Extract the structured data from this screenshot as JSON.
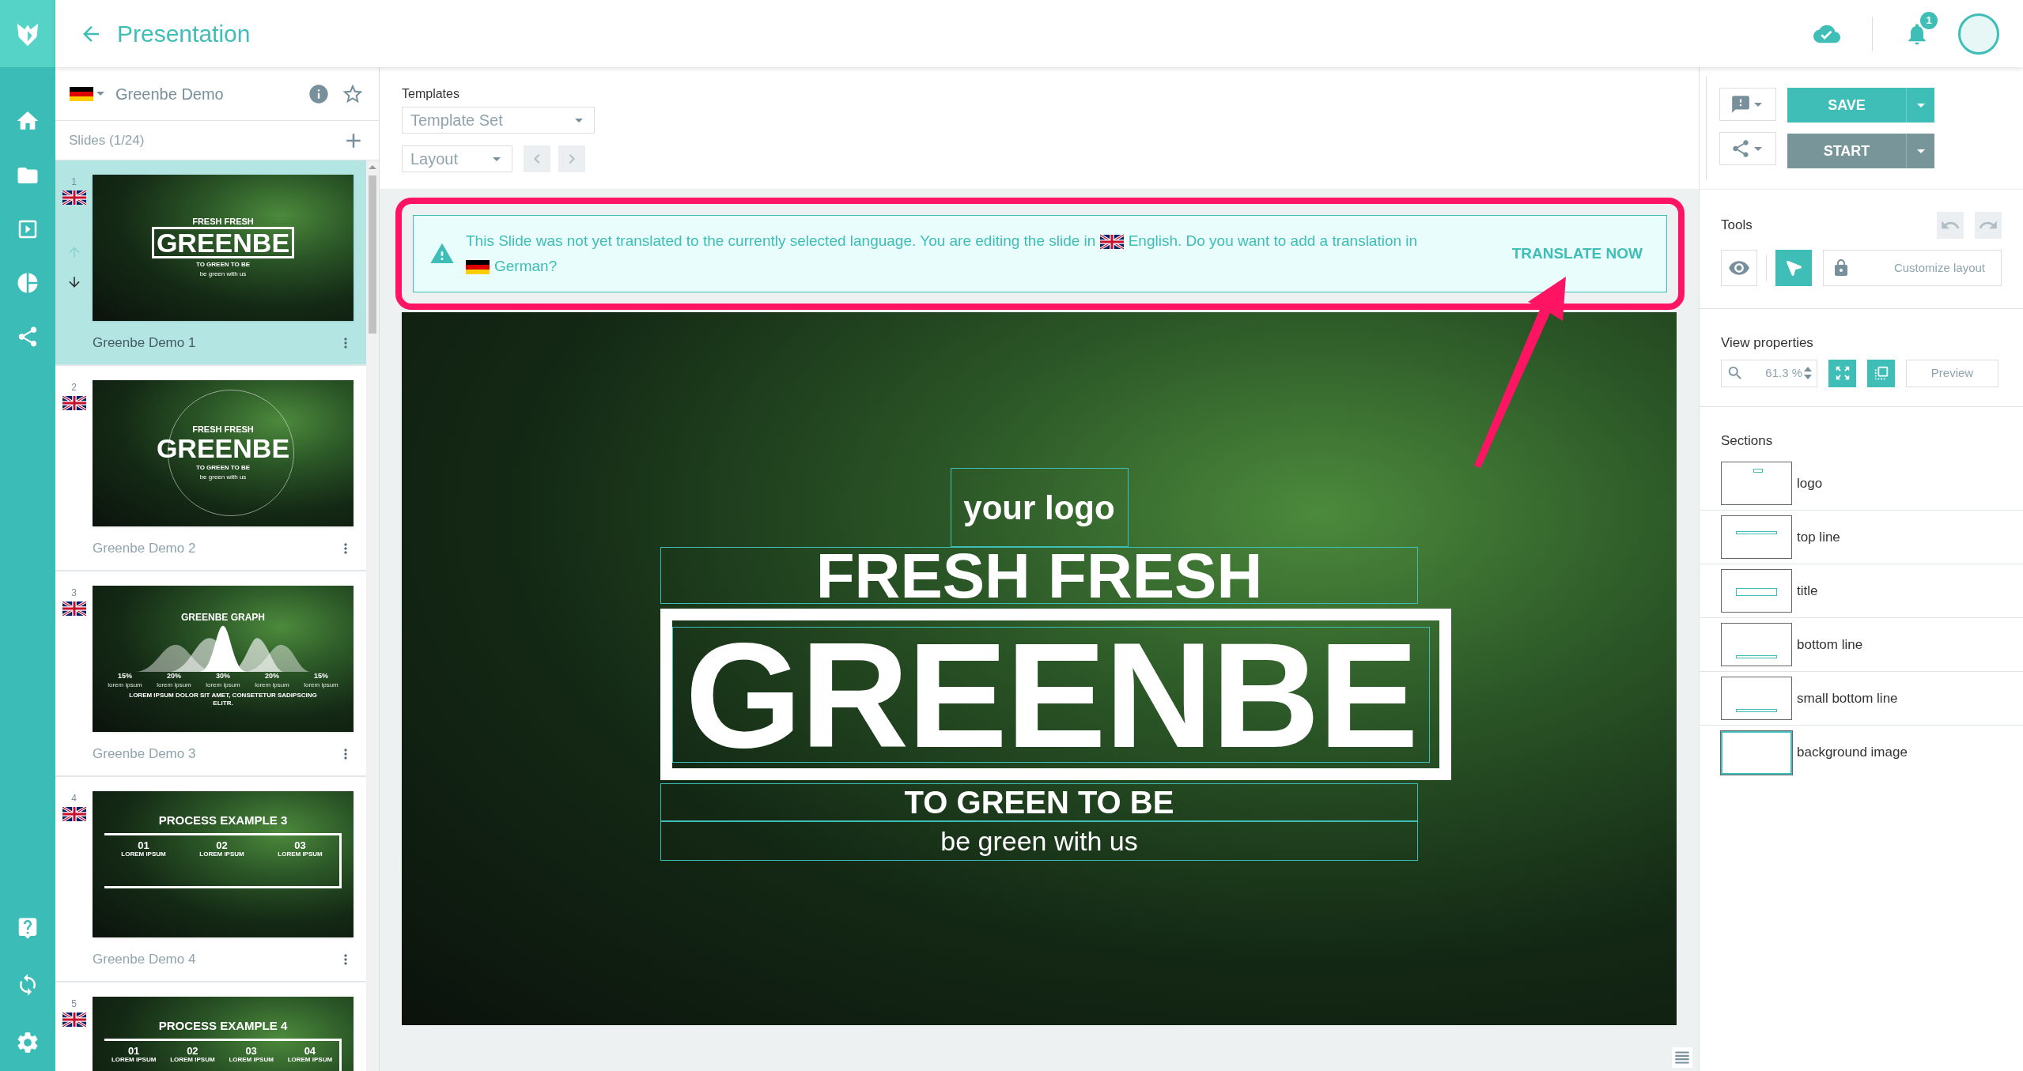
{
  "header": {
    "title": "Presentation",
    "notification_count": "1"
  },
  "presentation": {
    "name": "Greenbe Demo",
    "starred": false
  },
  "slides_header": {
    "label": "Slides (1/24)"
  },
  "move_controls": {
    "up_disabled": true,
    "down_disabled": false
  },
  "slides": [
    {
      "number": "1",
      "title": "Greenbe Demo 1",
      "selected": true,
      "thumb": {
        "kind": "title-box",
        "heading": "FRESH FRESH",
        "title": "GREENBE",
        "subtitle": "TO GREEN TO BE",
        "tagline": "be green with us"
      }
    },
    {
      "number": "2",
      "title": "Greenbe Demo 2",
      "selected": false,
      "thumb": {
        "kind": "title-circle",
        "heading": "FRESH FRESH",
        "title": "GREENBE",
        "subtitle": "TO GREEN TO BE",
        "tagline": "be green with us"
      }
    },
    {
      "number": "3",
      "title": "Greenbe Demo 3",
      "selected": false,
      "thumb": {
        "kind": "graph",
        "title": "GREENBE GRAPH",
        "items": [
          {
            "value": "15%",
            "label": "lorem ipsum"
          },
          {
            "value": "20%",
            "label": "lorem ipsum"
          },
          {
            "value": "30%",
            "label": "lorem ipsum"
          },
          {
            "value": "20%",
            "label": "lorem ipsum"
          },
          {
            "value": "15%",
            "label": "lorem ipsum"
          }
        ],
        "caption": "LOREM IPSUM DOLOR SIT AMET, CONSETETUR SADIPSCING ELITR."
      }
    },
    {
      "number": "4",
      "title": "Greenbe Demo 4",
      "selected": false,
      "thumb": {
        "kind": "process",
        "title": "PROCESS EXAMPLE 3",
        "steps": [
          {
            "number": "01",
            "label": "LOREM IPSUM"
          },
          {
            "number": "02",
            "label": "LOREM IPSUM"
          },
          {
            "number": "03",
            "label": "LOREM IPSUM"
          }
        ]
      }
    },
    {
      "number": "5",
      "selected": false,
      "thumb": {
        "kind": "process",
        "title": "PROCESS EXAMPLE 4",
        "steps": [
          {
            "number": "01",
            "label": "LOREM IPSUM"
          },
          {
            "number": "02",
            "label": "LOREM IPSUM"
          },
          {
            "number": "03",
            "label": "LOREM IPSUM"
          },
          {
            "number": "04",
            "label": "LOREM IPSUM"
          }
        ]
      }
    }
  ],
  "toolbar": {
    "templates_label": "Templates",
    "template_select": "Template Set",
    "layout_select": "Layout",
    "layout_nav_disabled": true,
    "save": "SAVE",
    "start": "START"
  },
  "notice": {
    "parts": [
      {
        "kind": "text",
        "text": "This Slide was not yet translated to the currently selected language. You are editing the slide in"
      },
      {
        "kind": "uk-flag"
      },
      {
        "kind": "text",
        "text": "English. Do you want to add a translation in"
      },
      {
        "kind": "de-flag"
      },
      {
        "kind": "text",
        "text": "German?"
      }
    ],
    "action": "TRANSLATE NOW"
  },
  "slide": {
    "logo": "your logo",
    "heading": "FRESH FRESH",
    "title": "GREENBE",
    "subtitle": "TO GREEN TO BE",
    "tagline": "be green with us"
  },
  "tools": {
    "label": "Tools",
    "undo_disabled": true,
    "redo_disabled": true,
    "modes": [
      {
        "kind": "view",
        "selected": false
      },
      {
        "kind": "select",
        "selected": true
      }
    ],
    "locked": true,
    "customize": "Customize layout"
  },
  "view_properties": {
    "label": "View properties",
    "zoom": "61.3 %",
    "preview": "Preview"
  },
  "sections": {
    "label": "Sections",
    "items": [
      {
        "name": "logo",
        "kind": "logo"
      },
      {
        "name": "top line",
        "kind": "top-line"
      },
      {
        "name": "title",
        "kind": "block"
      },
      {
        "name": "bottom line",
        "kind": "bottom-line"
      },
      {
        "name": "small bottom line",
        "kind": "bottom-line"
      },
      {
        "name": "background image",
        "kind": "full"
      }
    ]
  }
}
